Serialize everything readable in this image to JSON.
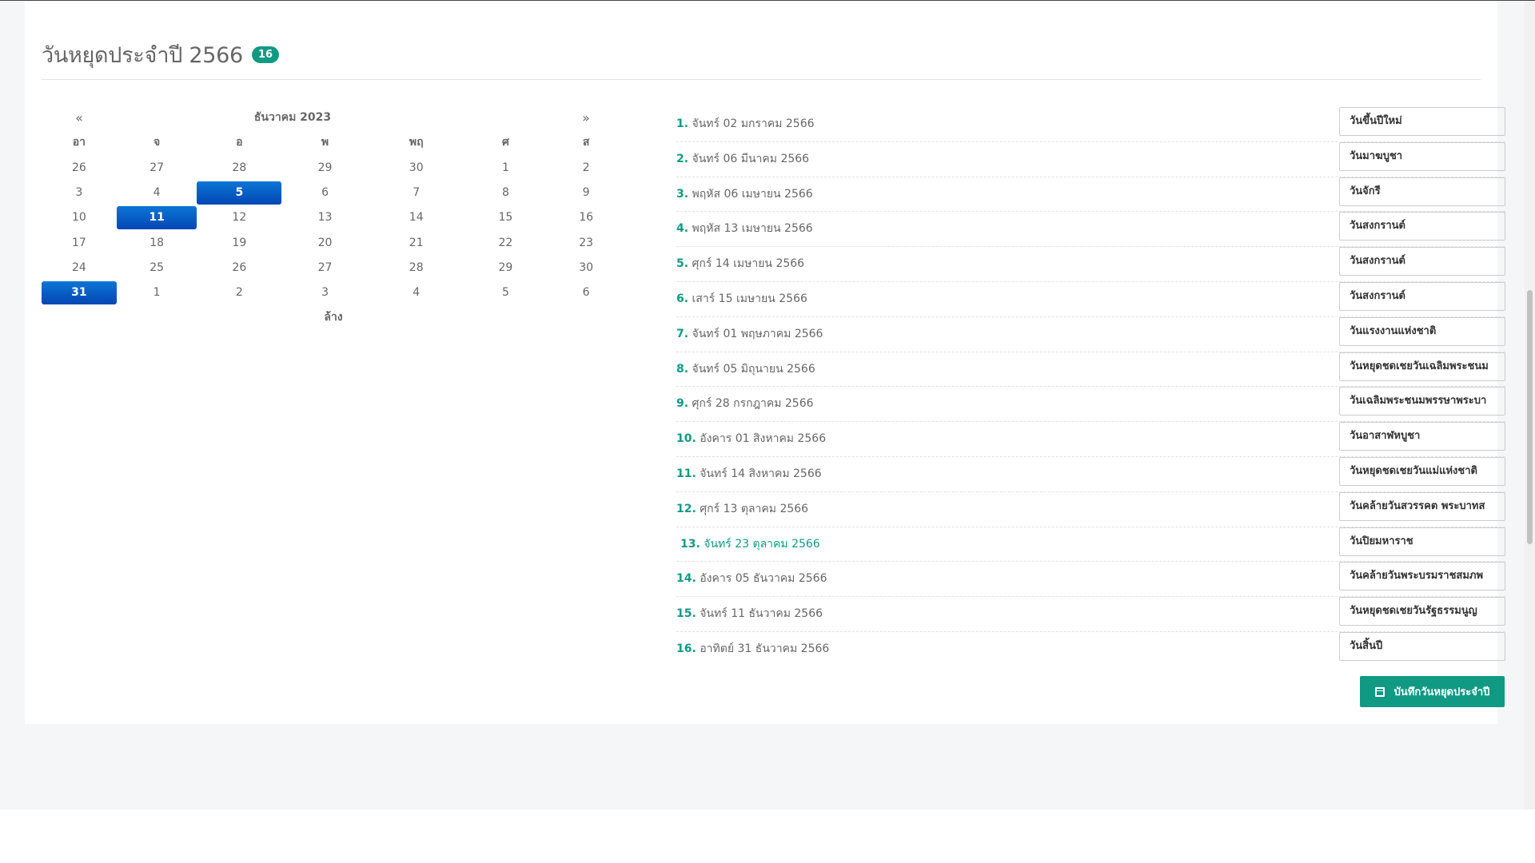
{
  "header": {
    "title": "วันหยุดประจำปี 2566",
    "count": "16"
  },
  "calendar": {
    "prev": "«",
    "next": "»",
    "month_title": "ธันวาคม 2023",
    "weekdays": [
      "อา",
      "จ",
      "อ",
      "พ",
      "พฤ",
      "ศ",
      "ส"
    ],
    "weeks": [
      [
        "26",
        "27",
        "28",
        "29",
        "30",
        "1",
        "2"
      ],
      [
        "3",
        "4",
        "5",
        "6",
        "7",
        "8",
        "9"
      ],
      [
        "10",
        "11",
        "12",
        "13",
        "14",
        "15",
        "16"
      ],
      [
        "17",
        "18",
        "19",
        "20",
        "21",
        "22",
        "23"
      ],
      [
        "24",
        "25",
        "26",
        "27",
        "28",
        "29",
        "30"
      ],
      [
        "31",
        "1",
        "2",
        "3",
        "4",
        "5",
        "6"
      ]
    ],
    "clear_label": "ล้าง"
  },
  "holidays": [
    {
      "num": "1.",
      "date": "จันทร์ 02 มกราคม 2566",
      "name": "วันขึ้นปีใหม่"
    },
    {
      "num": "2.",
      "date": "จันทร์ 06 มีนาคม 2566",
      "name": "วันมาฆบูชา"
    },
    {
      "num": "3.",
      "date": "พฤหัส 06 เมษายน 2566",
      "name": "วันจักรี"
    },
    {
      "num": "4.",
      "date": "พฤหัส 13 เมษายน 2566",
      "name": "วันสงกรานต์"
    },
    {
      "num": "5.",
      "date": "ศุกร์ 14 เมษายน 2566",
      "name": "วันสงกรานต์"
    },
    {
      "num": "6.",
      "date": "เสาร์ 15 เมษายน 2566",
      "name": "วันสงกรานต์"
    },
    {
      "num": "7.",
      "date": "จันทร์ 01 พฤษภาคม 2566",
      "name": "วันแรงงานแห่งชาติ"
    },
    {
      "num": "8.",
      "date": "จันทร์ 05 มิถุนายน 2566",
      "name": "วันหยุดชดเชยวันเฉลิมพระชนม"
    },
    {
      "num": "9.",
      "date": "ศุกร์ 28 กรกฎาคม 2566",
      "name": "วันเฉลิมพระชนมพรรษาพระบา"
    },
    {
      "num": "10.",
      "date": "อังคาร 01 สิงหาคม 2566",
      "name": "วันอาสาฬหบูชา"
    },
    {
      "num": "11.",
      "date": "จันทร์ 14 สิงหาคม 2566",
      "name": "วันหยุดชดเชยวันแม่แห่งชาติ"
    },
    {
      "num": "12.",
      "date": "ศุกร์ 13 ตุลาคม 2566",
      "name": "วันคล้ายวันสวรรคต พระบาทส"
    },
    {
      "num": "13.",
      "date": "จันทร์ 23 ตุลาคม 2566",
      "name": "วันปิยมหาราช"
    },
    {
      "num": "14.",
      "date": "อังคาร 05 ธันวาคม 2566",
      "name": "วันคล้ายวันพระบรมราชสมภพ"
    },
    {
      "num": "15.",
      "date": "จันทร์ 11 ธันวาคม 2566",
      "name": "วันหยุดชดเชยวันรัฐธรรมนูญ"
    },
    {
      "num": "16.",
      "date": "อาทิตย์ 31 ธันวาคม 2566",
      "name": "วันสิ้นปี"
    }
  ],
  "save_button": {
    "label": "บันทึกวันหยุดประจำปี",
    "icon": "calendar-icon"
  },
  "colors": {
    "accent": "#109a84",
    "selected": "#0b5fc4"
  }
}
